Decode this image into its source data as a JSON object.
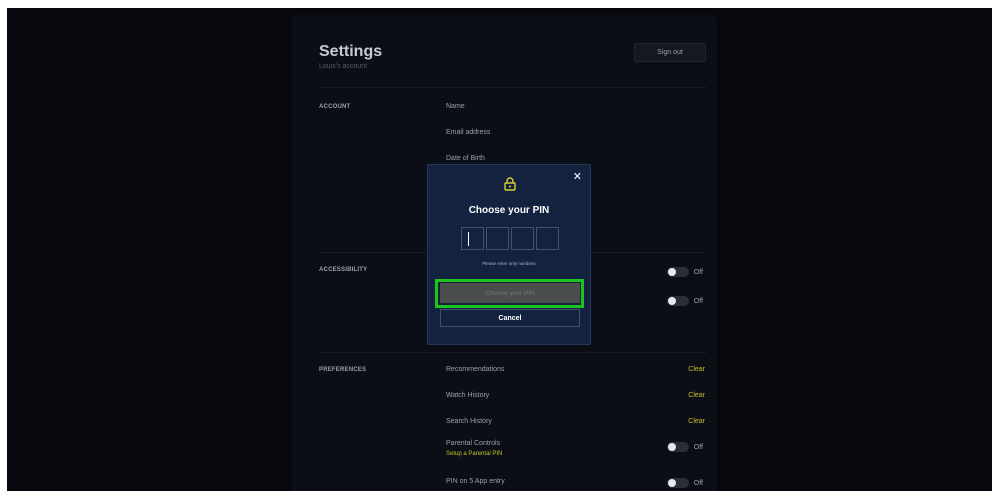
{
  "header": {
    "title": "Settings",
    "subtitle": "Louis's account",
    "sign_out_label": "Sign out"
  },
  "account": {
    "section_label": "ACCOUNT",
    "rows": [
      "Name",
      "Email address",
      "Date of Birth"
    ]
  },
  "accessibility": {
    "section_label": "ACCESSIBILITY",
    "toggles": [
      {
        "state_label": "Off",
        "on": false
      },
      {
        "state_label": "Off",
        "on": false
      }
    ]
  },
  "preferences": {
    "section_label": "PREFERENCES",
    "recommendations": {
      "label": "Recommendations",
      "action": "Clear"
    },
    "watch_history": {
      "label": "Watch History",
      "action": "Clear"
    },
    "search_history": {
      "label": "Search History",
      "action": "Clear"
    },
    "parental_controls": {
      "label": "Parental Controls",
      "sub": "Setup a Parental PIN",
      "state_label": "Off",
      "on": false
    },
    "pin_entry": {
      "label": "PIN on 5 App entry",
      "state_label": "Off",
      "on": false
    }
  },
  "pin_modal": {
    "icon": "lock-icon",
    "close_icon": "close-icon",
    "title": "Choose your PIN",
    "digits": [
      "",
      "",
      "",
      ""
    ],
    "hint": "Please enter only numbers",
    "choose_label": "Choose your PIN",
    "cancel_label": "Cancel"
  },
  "colors": {
    "accent": "#c4c02a",
    "modal_bg": "#13233f",
    "highlight": "#1ec41e"
  }
}
